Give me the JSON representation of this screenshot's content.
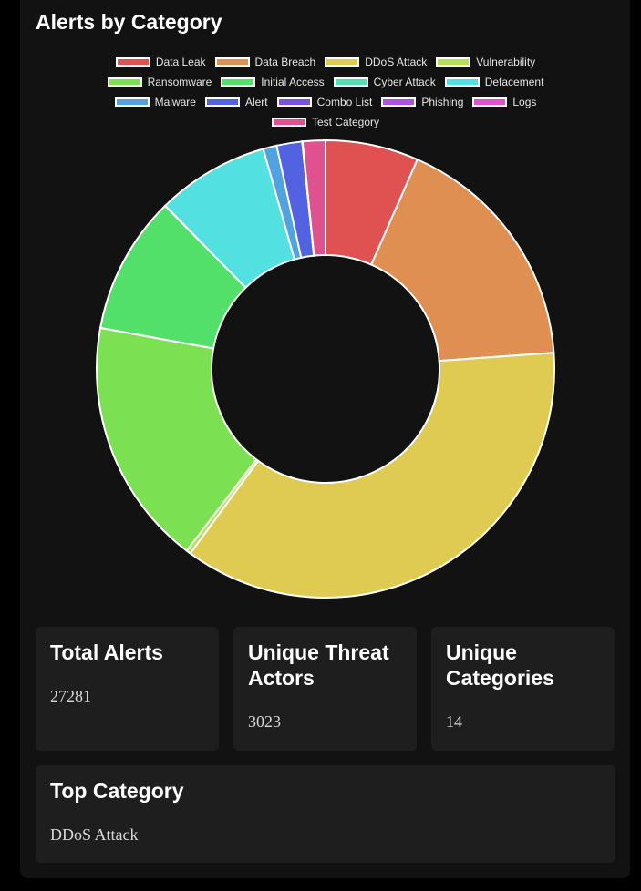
{
  "panel": {
    "title": "Alerts by Category"
  },
  "chart_data": {
    "type": "doughnut",
    "title": "Alerts by Category",
    "legend_position": "top",
    "categories": [
      "Data Leak",
      "Data Breach",
      "DDoS Attack",
      "Vulnerability",
      "Ransomware",
      "Initial Access",
      "Cyber Attack",
      "Defacement",
      "Malware",
      "Alert",
      "Combo List",
      "Phishing",
      "Logs",
      "Test Category"
    ],
    "colors": [
      "#e05252",
      "#e08f52",
      "#e0cb52",
      "#b5e052",
      "#7be052",
      "#52e06b",
      "#52e0b0",
      "#52e0e0",
      "#52a2e0",
      "#5262e0",
      "#7a52e0",
      "#b052e0",
      "#e052cb",
      "#e0528f"
    ],
    "values": [
      1794,
      4719,
      9873,
      85,
      4775,
      2665,
      2,
      2171,
      262,
      491,
      3,
      2,
      2,
      437
    ],
    "total": 27281
  },
  "stats": {
    "total_alerts": {
      "label": "Total Alerts",
      "value": "27281"
    },
    "unique_actors": {
      "label": "Unique Threat Actors",
      "value": "3023"
    },
    "unique_categories": {
      "label": "Unique Categories",
      "value": "14"
    },
    "top_category": {
      "label": "Top Category",
      "value": "DDoS Attack"
    }
  }
}
